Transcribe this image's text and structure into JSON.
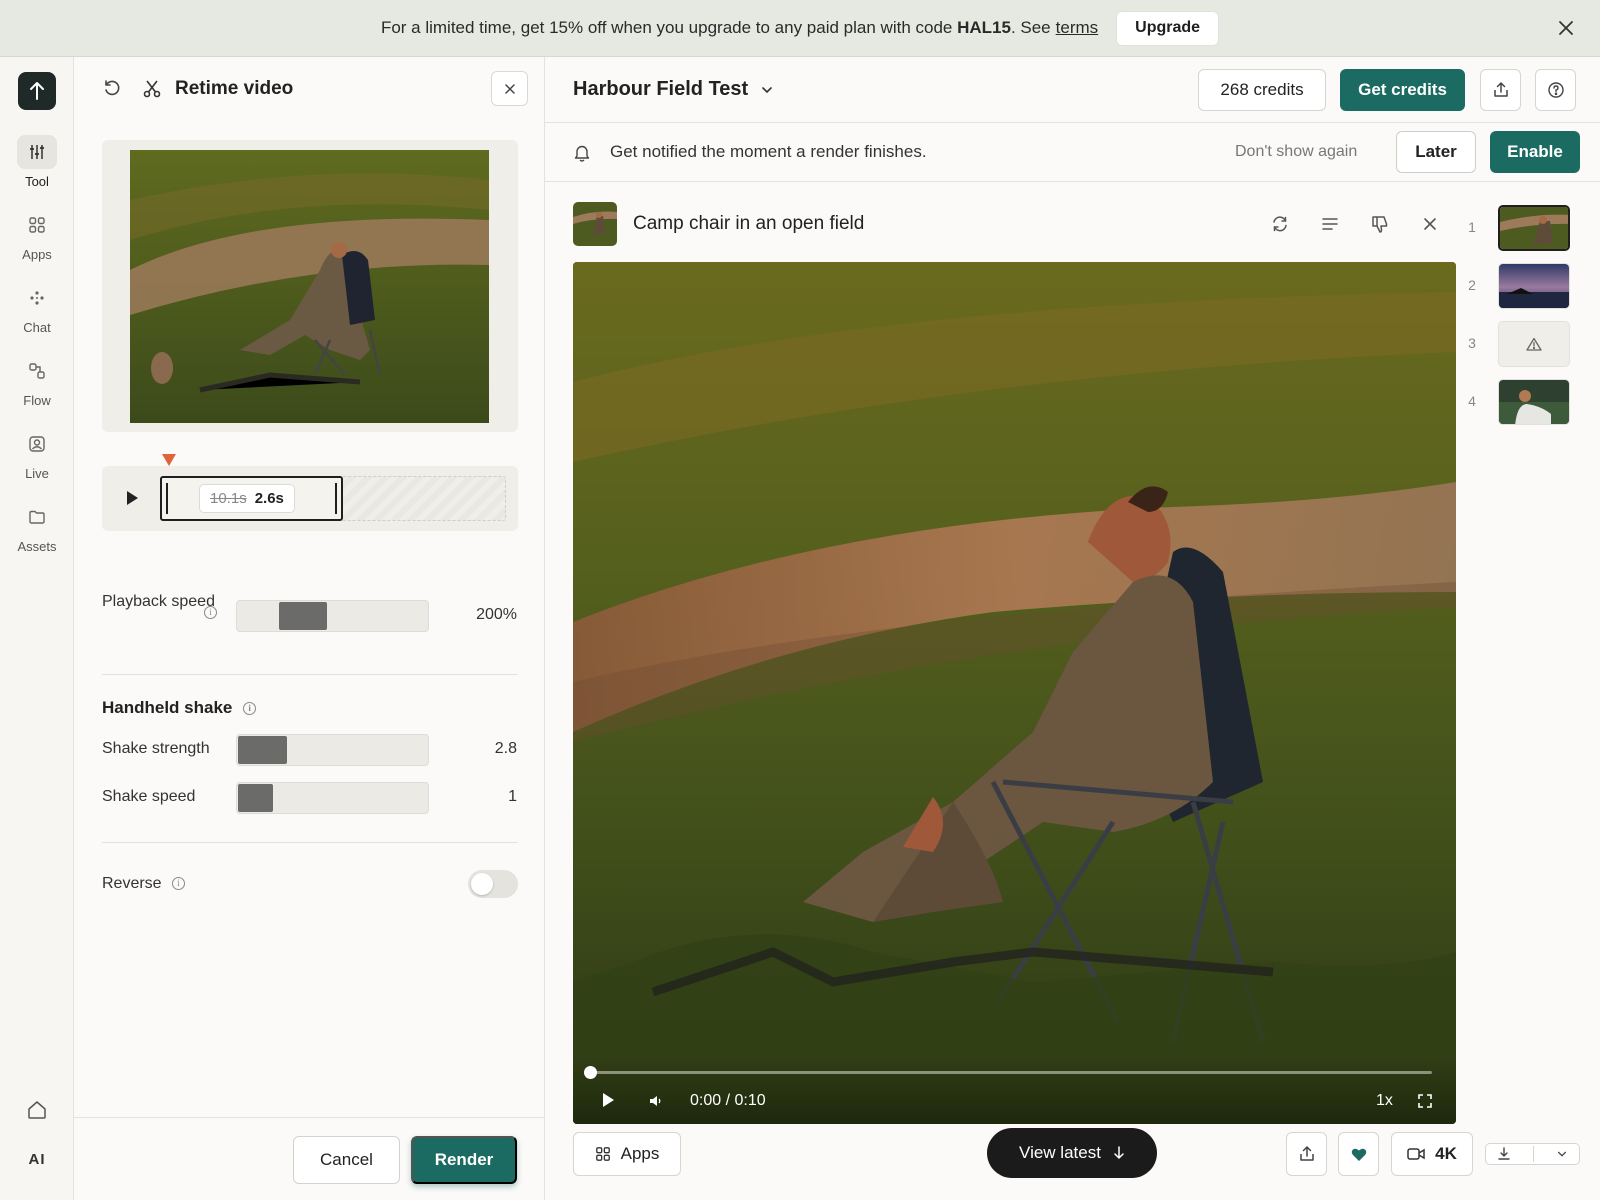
{
  "banner": {
    "text_before_code": "For a limited time, get 15% off when you upgrade to any paid plan with code ",
    "code": "HAL15",
    "text_after_code": ". See",
    "terms_link": "terms",
    "upgrade_button": "Upgrade",
    "close_icon": "close-icon"
  },
  "rail": {
    "items": [
      {
        "label": "Tool",
        "icon": "sliders-icon",
        "active": true
      },
      {
        "label": "Apps",
        "icon": "grid-icon"
      },
      {
        "label": "Chat",
        "icon": "sparkle-dots-icon"
      },
      {
        "label": "Flow",
        "icon": "flow-icon"
      },
      {
        "label": "Live",
        "icon": "person-badge-icon"
      },
      {
        "label": "Assets",
        "icon": "folder-icon"
      }
    ],
    "ai_label": "AI"
  },
  "panel": {
    "title": "Retime video",
    "trim": {
      "original_duration": "10.1s",
      "new_duration": "2.6s"
    },
    "playback_speed": {
      "label": "Playback speed",
      "value": "200%",
      "fill_fraction": 0.2
    },
    "handheld_shake": {
      "title": "Handheld shake",
      "strength": {
        "label": "Shake strength",
        "value": "2.8",
        "fill_fraction": 0.26
      },
      "speed": {
        "label": "Shake speed",
        "value": "1",
        "fill_fraction": 0.19
      }
    },
    "reverse": {
      "label": "Reverse",
      "on": false
    },
    "cancel_button": "Cancel",
    "render_button": "Render"
  },
  "main": {
    "project_title": "Harbour Field Test",
    "credits": "268 credits",
    "get_credits_button": "Get credits",
    "notification": {
      "text": "Get notified the moment a render finishes.",
      "dont_show": "Don't show again",
      "later_button": "Later",
      "enable_button": "Enable"
    },
    "card": {
      "title": "Camp chair in an open field",
      "video_time": "0:00 / 0:10",
      "playback_rate": "1x",
      "progress_fraction": 0.0
    },
    "thumbnails": [
      {
        "num": "1",
        "selected": true
      },
      {
        "num": "2"
      },
      {
        "num": "3",
        "status": "warning-icon"
      },
      {
        "num": "4"
      }
    ],
    "bottom": {
      "apps_button": "Apps",
      "view_latest_button": "View latest",
      "quality_button": "4K"
    }
  },
  "colors": {
    "accent": "#1c6b62",
    "marker": "#e0643a",
    "dark": "#1b1b1b"
  }
}
